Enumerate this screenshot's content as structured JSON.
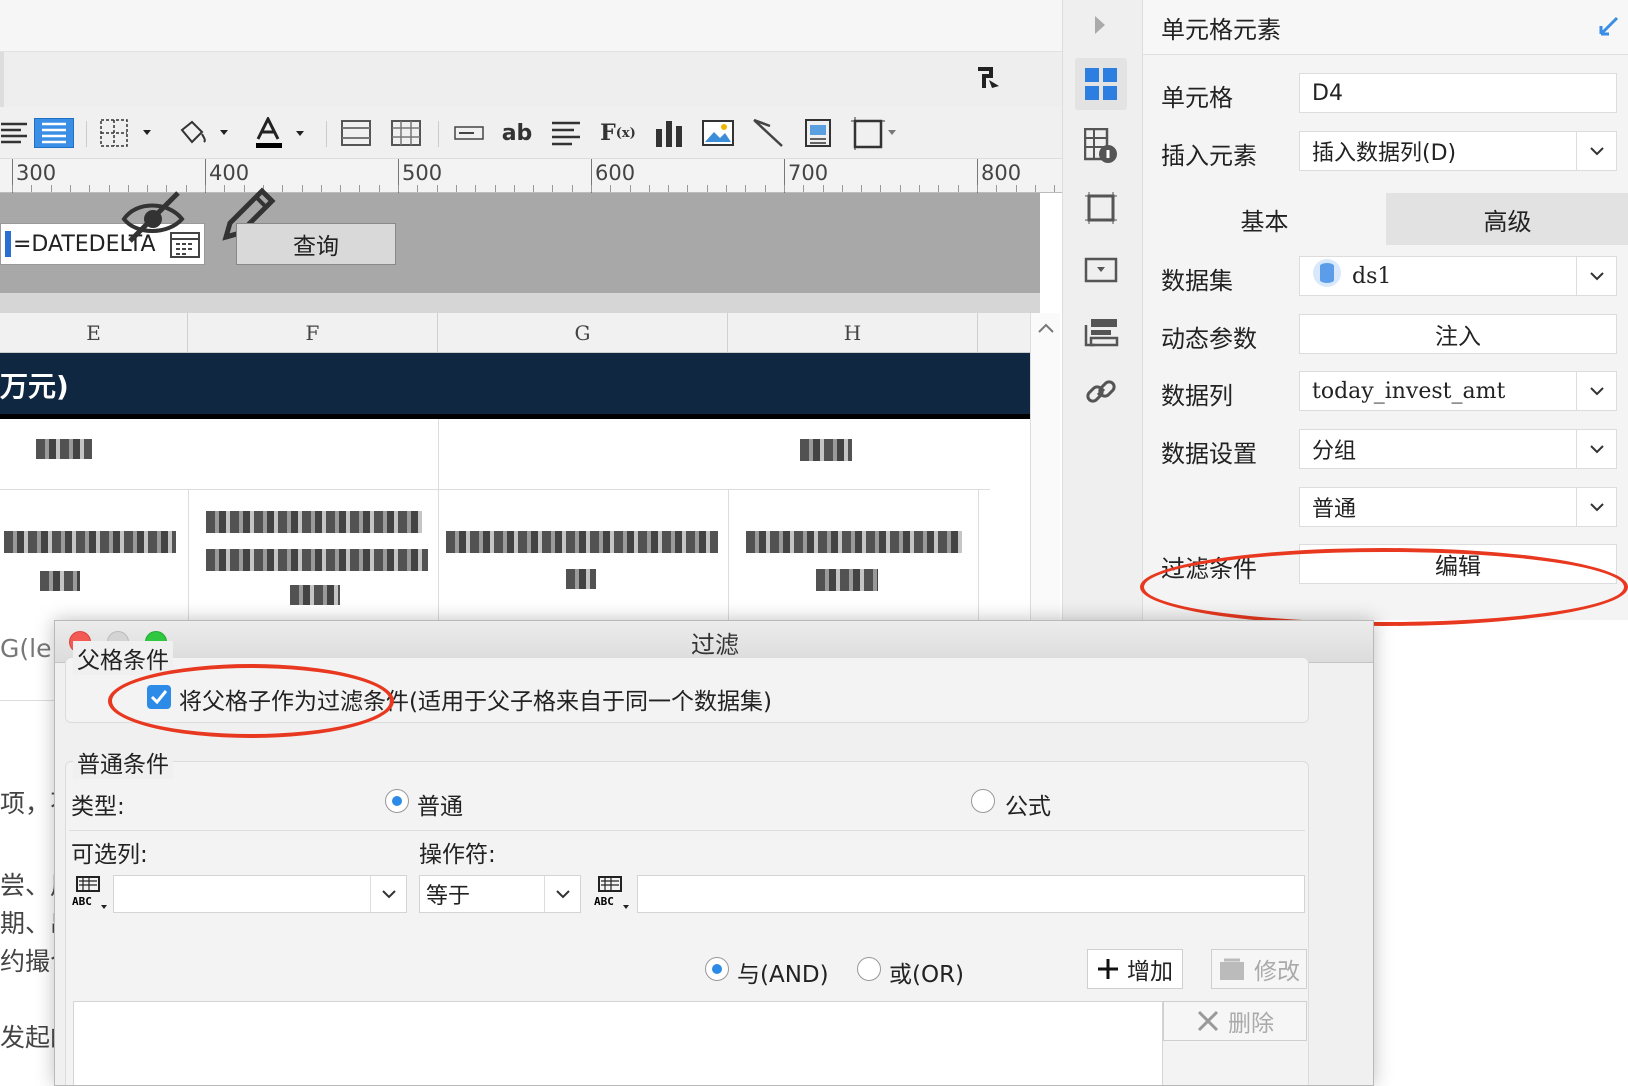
{
  "designer": {
    "ruler_labels": [
      "300",
      "400",
      "500",
      "600",
      "700",
      "800"
    ],
    "date_widget_label": "=DATEDELTA",
    "query_button": "查询",
    "column_headers": [
      "E",
      "F",
      "G",
      "H"
    ],
    "title_fragment": "万元)"
  },
  "side_icons": [
    "cell-element-icon",
    "cell-attribute-icon",
    "border-icon",
    "widget-icon",
    "float-element-icon",
    "link-icon"
  ],
  "panel": {
    "title": "单元格元素",
    "cell_label": "单元格",
    "cell_value": "D4",
    "insert_label": "插入元素",
    "insert_value": "插入数据列(D)",
    "tab_basic": "基本",
    "tab_advanced": "高级",
    "dataset_label": "数据集",
    "dataset_value": "ds1",
    "dynamic_param_label": "动态参数",
    "dynamic_param_button": "注入",
    "data_column_label": "数据列",
    "data_column_value": "today_invest_amt",
    "data_setting_label": "数据设置",
    "data_setting_value": "分组",
    "data_setting_mode": "普通",
    "filter_label": "过滤条件",
    "filter_button": "编辑"
  },
  "behind": {
    "lines": [
      "G(le",
      "项，不",
      "尝、用",
      "期、出",
      "约撮合",
      "发起的"
    ]
  },
  "dialog": {
    "title": "过滤",
    "parent_group_title": "父格条件",
    "parent_checkbox_label": "将父格子作为过滤条件(适用于父子格来自于同一个数据集)",
    "parent_checkbox_checked": true,
    "normal_group_title": "普通条件",
    "type_label": "类型:",
    "type_normal": "普通",
    "type_formula": "公式",
    "type_selected": "普通",
    "optional_column_label": "可选列:",
    "operator_label": "操作符:",
    "optional_column_value": "",
    "operator_value": "等于",
    "value_input": "",
    "logic_and": "与(AND)",
    "logic_or": "或(OR)",
    "logic_selected": "与(AND)",
    "add_button": "增加",
    "modify_button": "修改",
    "delete_button": "删除"
  },
  "colors": {
    "accent": "#2b8be6",
    "highlight_ellipse": "#e8381f",
    "title_band": "#0f2740"
  }
}
